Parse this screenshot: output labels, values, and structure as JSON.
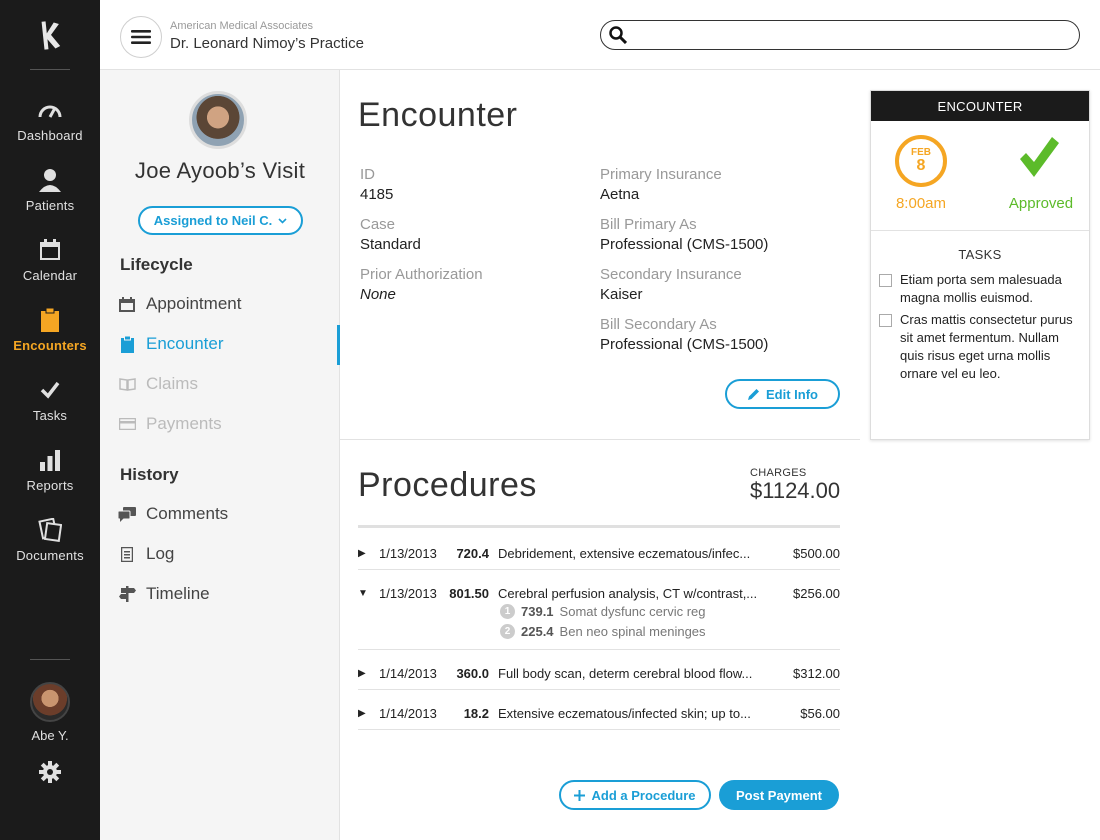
{
  "nav": {
    "items": [
      {
        "label": "Dashboard",
        "icon": "gauge-icon"
      },
      {
        "label": "Patients",
        "icon": "person-icon"
      },
      {
        "label": "Calendar",
        "icon": "calendar-icon"
      },
      {
        "label": "Encounters",
        "icon": "clipboard-icon",
        "active": true
      },
      {
        "label": "Tasks",
        "icon": "check-icon"
      },
      {
        "label": "Reports",
        "icon": "bar-chart-icon"
      },
      {
        "label": "Documents",
        "icon": "documents-icon"
      }
    ],
    "user_name": "Abe Y.",
    "accent_color": "#f5a623"
  },
  "header": {
    "practice_org": "American Medical Associates",
    "practice_name": "Dr. Leonard Nimoy’s Practice",
    "search_placeholder": ""
  },
  "sidebar": {
    "visit_title": "Joe Ayoob’s Visit",
    "assigned_label": "Assigned to Neil C.",
    "lifecycle_heading": "Lifecycle",
    "lifecycle": [
      {
        "label": "Appointment",
        "icon": "calendar-icon",
        "state": "normal"
      },
      {
        "label": "Encounter",
        "icon": "clipboard-icon",
        "state": "active"
      },
      {
        "label": "Claims",
        "icon": "book-icon",
        "state": "disabled"
      },
      {
        "label": "Payments",
        "icon": "credit-card-icon",
        "state": "disabled"
      }
    ],
    "history_heading": "History",
    "history": [
      {
        "label": "Comments",
        "icon": "comments-icon"
      },
      {
        "label": "Log",
        "icon": "log-icon"
      },
      {
        "label": "Timeline",
        "icon": "signpost-icon"
      }
    ]
  },
  "encounter": {
    "title": "Encounter",
    "fields": {
      "id_label": "ID",
      "id_value": "4185",
      "case_label": "Case",
      "case_value": "Standard",
      "prior_label": "Prior Authorization",
      "prior_value": "None",
      "primary_ins_label": "Primary Insurance",
      "primary_ins_value": "Aetna",
      "bill_primary_label": "Bill Primary As",
      "bill_primary_value": "Professional (CMS-1500)",
      "secondary_ins_label": "Secondary Insurance",
      "secondary_ins_value": "Kaiser",
      "bill_secondary_label": "Bill Secondary As",
      "bill_secondary_value": "Professional (CMS-1500)"
    },
    "edit_label": "Edit Info"
  },
  "procedures": {
    "title": "Procedures",
    "charges_label": "CHARGES",
    "charges_value": "$1124.00",
    "rows": [
      {
        "date": "1/13/2013",
        "code": "720.4",
        "desc": "Debridement, extensive eczematous/infec...",
        "amount": "$500.00",
        "expanded": false
      },
      {
        "date": "1/13/2013",
        "code": "801.50",
        "desc": "Cerebral perfusion analysis, CT w/contrast,...",
        "amount": "$256.00",
        "expanded": true,
        "sub": [
          {
            "n": "1",
            "code": "739.1",
            "desc": "Somat dysfunc cervic reg"
          },
          {
            "n": "2",
            "code": "225.4",
            "desc": "Ben neo spinal meninges"
          }
        ]
      },
      {
        "date": "1/14/2013",
        "code": "360.0",
        "desc": "Full body scan, determ cerebral blood flow...",
        "amount": "$312.00",
        "expanded": false
      },
      {
        "date": "1/14/2013",
        "code": "18.2",
        "desc": "Extensive eczematous/infected skin; up to...",
        "amount": "$56.00",
        "expanded": false
      }
    ],
    "add_label": "Add a Procedure",
    "post_label": "Post Payment"
  },
  "card": {
    "heading": "ENCOUNTER",
    "month": "FEB",
    "day": "8",
    "time": "8:00am",
    "status": "Approved",
    "tasks_heading": "TASKS",
    "tasks": [
      "Etiam porta sem malesuada magna mollis euismod.",
      "Cras mattis consectetur purus sit amet fermentum. Nullam quis risus eget urna mollis ornare vel eu leo."
    ]
  },
  "colors": {
    "primary": "#1a9ed6",
    "nav_bg": "#1b1b1b",
    "approved": "#5cbb2a"
  }
}
